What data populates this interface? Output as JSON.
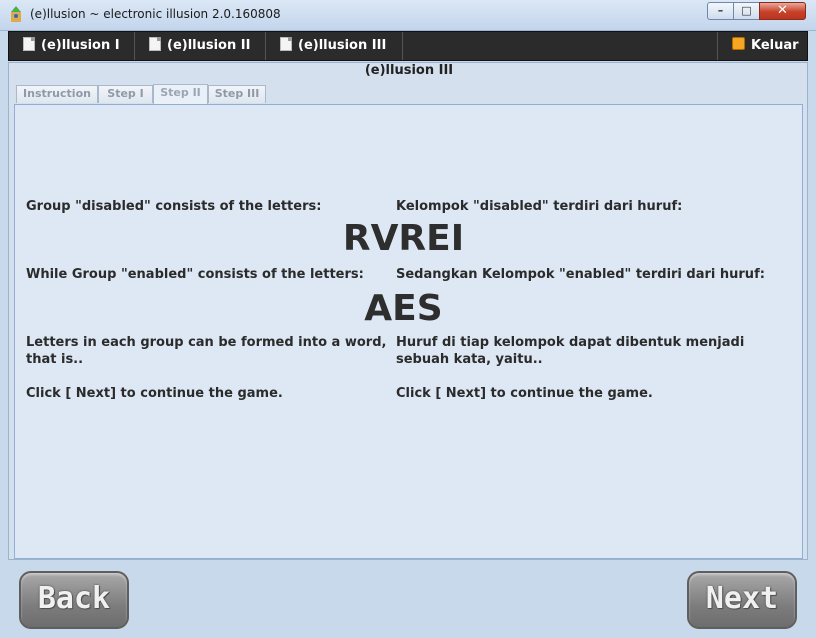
{
  "window": {
    "title": "(e)llusion ~ electronic illusion 2.0.160808",
    "min_label": "–",
    "max_label": "□",
    "close_label": "✕"
  },
  "menu": {
    "items": [
      "(e)llusion I",
      "(e)llusion II",
      "(e)llusion III"
    ],
    "exit_label": "Keluar",
    "item_icon": "document-icon",
    "exit_icon": "exit-icon"
  },
  "panel": {
    "title": "(e)llusion III",
    "tabs": [
      "Instruction",
      "Step I",
      "Step II",
      "Step III"
    ],
    "active_tab": "Step II"
  },
  "content": {
    "en": {
      "disabled_line": "Group \"disabled\" consists of the letters:",
      "enabled_line": "While Group \"enabled\" consists of the letters:",
      "word_line_1": "Letters in each group can be formed into a word,",
      "word_line_2": "that is..",
      "continue_line": "Click [ Next] to continue the game."
    },
    "id": {
      "disabled_line": "Kelompok \"disabled\" terdiri dari huruf:",
      "enabled_line": "Sedangkan Kelompok \"enabled\" terdiri dari huruf:",
      "word_line_1": "Huruf di tiap kelompok dapat dibentuk menjadi",
      "word_line_2": "sebuah kata, yaitu..",
      "continue_line": "Click [ Next] to continue the game."
    },
    "disabled_letters": "RVREI",
    "enabled_letters": "AES"
  },
  "nav": {
    "back_label": "Back",
    "next_label": "Next"
  }
}
